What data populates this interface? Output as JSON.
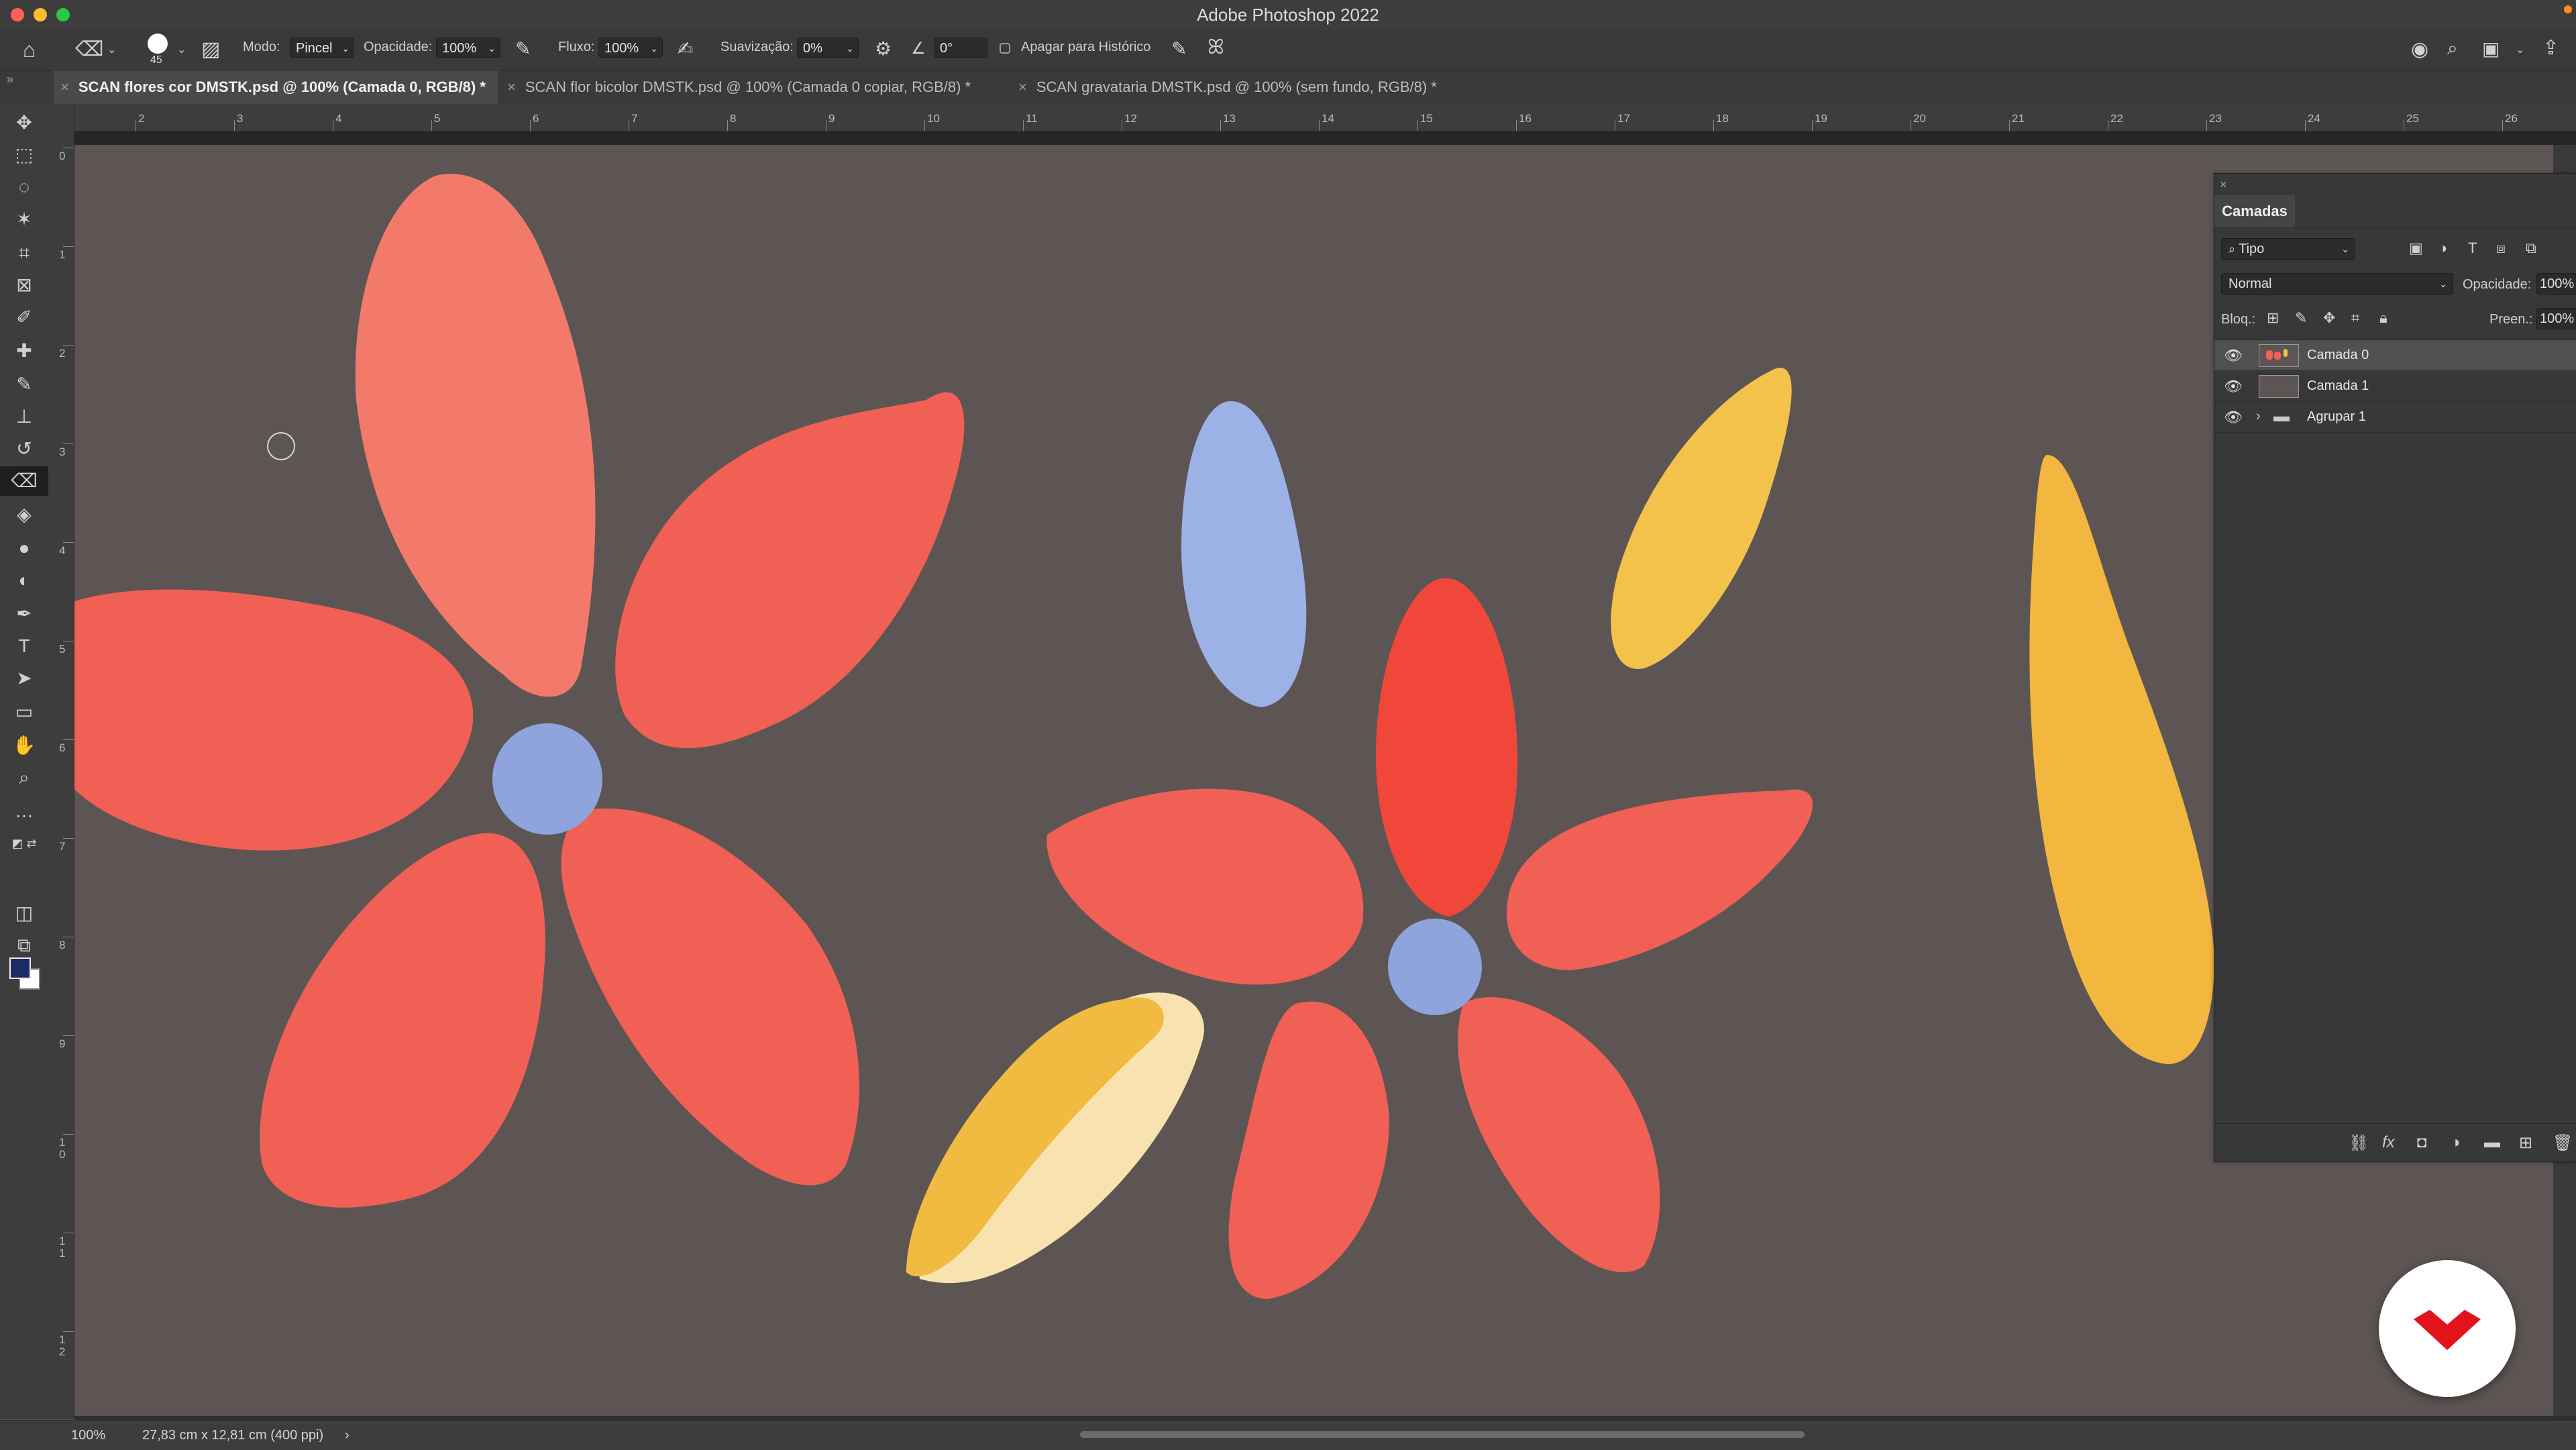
{
  "app": {
    "title": "Adobe Photoshop 2022"
  },
  "options_bar": {
    "brush_size": "45",
    "mode_label": "Modo:",
    "mode_value": "Pincel",
    "opacity_label": "Opacidade:",
    "opacity_value": "100%",
    "flow_label": "Fluxo:",
    "flow_value": "100%",
    "smoothing_label": "Suavização:",
    "smoothing_value": "0%",
    "angle_value": "0°",
    "erase_history_label": "Apagar para Histórico"
  },
  "tabs": [
    {
      "label": "SCAN flores cor DMSTK.psd @ 100% (Camada 0, RGB/8) *",
      "active": true
    },
    {
      "label": "SCAN flor bicolor DMSTK.psd @ 100% (Camada 0 copiar, RGB/8) *",
      "active": false
    },
    {
      "label": "SCAN gravataria DMSTK.psd @ 100% (sem fundo, RGB/8) *",
      "active": false
    }
  ],
  "rulers": {
    "top_labels": [
      "2",
      "3",
      "4",
      "5",
      "6",
      "7",
      "8",
      "9",
      "10",
      "11",
      "12",
      "13",
      "14",
      "15",
      "16",
      "17",
      "18",
      "19",
      "20",
      "21",
      "22",
      "23",
      "24",
      "25",
      "26"
    ],
    "left_labels": [
      "0",
      "1",
      "2",
      "3",
      "4",
      "5",
      "6",
      "7",
      "8",
      "9",
      "1\n0",
      "1\n1",
      "1\n2"
    ]
  },
  "layers_panel": {
    "title": "Camadas",
    "filter_kind": "Tipo",
    "blend_mode": "Normal",
    "opacity_label": "Opacidade:",
    "opacity_value": "100%",
    "lock_label": "Bloq.:",
    "fill_label": "Preen.:",
    "fill_value": "100%",
    "layers": [
      {
        "name": "Camada 0",
        "selected": true,
        "type": "layer"
      },
      {
        "name": "Camada 1",
        "selected": false,
        "type": "layer"
      },
      {
        "name": "Agrupar 1",
        "selected": false,
        "type": "group"
      }
    ]
  },
  "status_bar": {
    "zoom": "100%",
    "doc_info": "27,83 cm x 12,81 cm (400 ppi)"
  },
  "colors": {
    "canvas_bg": "#5c5554",
    "petal_red": "#f06054",
    "petal_pink_red": "#f37a6a",
    "petal_blue": "#9cb1e6",
    "petal_yellow": "#f3c24a",
    "petal_cream": "#f8e3b0",
    "logo_red": "#e2131a"
  }
}
